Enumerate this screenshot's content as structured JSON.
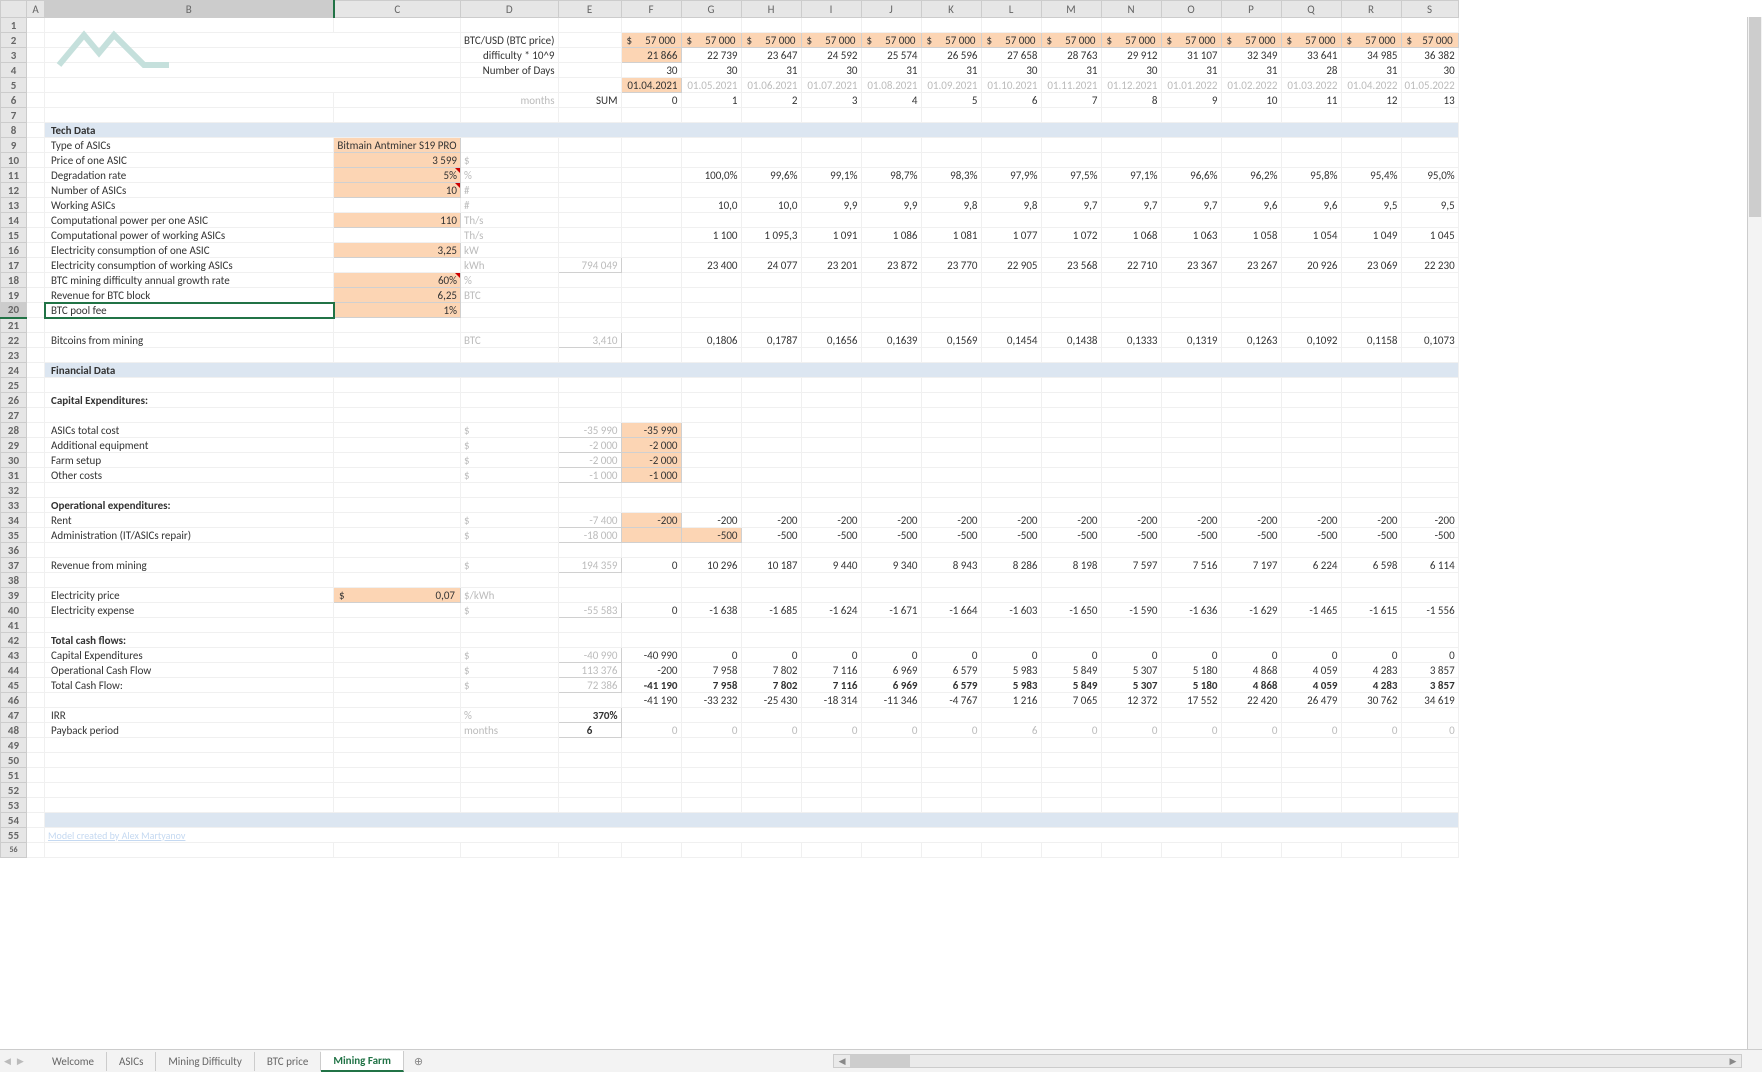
{
  "tabs": [
    "Welcome",
    "ASICs",
    "Mining Difficulty",
    "BTC price",
    "Mining Farm"
  ],
  "active_tab": "Mining Farm",
  "cols": [
    "A",
    "B",
    "C",
    "D",
    "E",
    "F",
    "G",
    "H",
    "I",
    "J",
    "K",
    "L",
    "M",
    "N",
    "O",
    "P",
    "Q",
    "R",
    "S"
  ],
  "rownums": 56,
  "r2_label": "BTC/USD (BTC price)",
  "r2_vals": [
    "57 000",
    "57 000",
    "57 000",
    "57 000",
    "57 000",
    "57 000",
    "57 000",
    "57 000",
    "57 000",
    "57 000",
    "57 000",
    "57 000",
    "57 000",
    "57 000"
  ],
  "r3_label": "difficulty * 10^9",
  "r3_first": "21 866",
  "r3_vals": [
    "22 739",
    "23 647",
    "24 592",
    "25 574",
    "26 596",
    "27 658",
    "28 763",
    "29 912",
    "31 107",
    "32 349",
    "33 641",
    "34 985",
    "36 382"
  ],
  "r4_label": "Number of Days",
  "r4_vals": [
    "30",
    "30",
    "31",
    "30",
    "31",
    "31",
    "30",
    "31",
    "30",
    "31",
    "31",
    "28",
    "31",
    "30"
  ],
  "r5_first": "01.04.2021",
  "r5_dates": [
    "01.05.2021",
    "01.06.2021",
    "01.07.2021",
    "01.08.2021",
    "01.09.2021",
    "01.10.2021",
    "01.11.2021",
    "01.12.2021",
    "01.01.2022",
    "01.02.2022",
    "01.03.2022",
    "01.04.2022",
    "01.05.2022"
  ],
  "r6_months": "months",
  "r6_sum": "SUM",
  "r6_nums": [
    "0",
    "1",
    "2",
    "3",
    "4",
    "5",
    "6",
    "7",
    "8",
    "9",
    "10",
    "11",
    "12",
    "13"
  ],
  "tech_header": "Tech Data",
  "r9_l": "Type of ASICs",
  "r9_v": "Bitmain Antminer S19 PRO",
  "r10_l": "Price of one ASIC",
  "r10_v": "3 599",
  "r10_u": "$",
  "r11_l": "Degradation rate",
  "r11_v": "5%",
  "r11_u": "%",
  "r11_vals": [
    "100,0%",
    "99,6%",
    "99,1%",
    "98,7%",
    "98,3%",
    "97,9%",
    "97,5%",
    "97,1%",
    "96,6%",
    "96,2%",
    "95,8%",
    "95,4%",
    "95,0%"
  ],
  "r12_l": "Number of ASICs",
  "r12_v": "10",
  "r12_u": "#",
  "r13_l": "Working ASICs",
  "r13_u": "#",
  "r13_vals": [
    "10,0",
    "10,0",
    "9,9",
    "9,9",
    "9,8",
    "9,8",
    "9,7",
    "9,7",
    "9,7",
    "9,6",
    "9,6",
    "9,5",
    "9,5"
  ],
  "r14_l": "Computational power per one ASIC",
  "r14_v": "110",
  "r14_u": "Th/s",
  "r15_l": "Computational power of working ASICs",
  "r15_u": "Th/s",
  "r15_vals": [
    "1 100",
    "1 095,3",
    "1 091",
    "1 086",
    "1 081",
    "1 077",
    "1 072",
    "1 068",
    "1 063",
    "1 058",
    "1 054",
    "1 049",
    "1 045"
  ],
  "r16_l": "Electricity consumption of one ASIC",
  "r16_v": "3,25",
  "r16_u": "kW",
  "r17_l": "Electricity consumption of working ASICs",
  "r17_u": "kWh",
  "r17_sum": "794 049",
  "r17_vals": [
    "23 400",
    "24 077",
    "23 201",
    "23 872",
    "23 770",
    "22 905",
    "23 568",
    "22 710",
    "23 367",
    "23 267",
    "20 926",
    "23 069",
    "22 230"
  ],
  "r18_l": "BTC mining difficulty annual growth rate",
  "r18_v": "60%",
  "r18_u": "%",
  "r19_l": "Revenue for BTC block",
  "r19_v": "6,25",
  "r19_u": "BTC",
  "r20_l": "BTC pool fee",
  "r20_v": "1%",
  "r22_l": "Bitcoins from mining",
  "r22_u": "BTC",
  "r22_sum": "3,410",
  "r22_vals": [
    "0,1806",
    "0,1787",
    "0,1656",
    "0,1639",
    "0,1569",
    "0,1454",
    "0,1438",
    "0,1333",
    "0,1319",
    "0,1263",
    "0,1092",
    "0,1158",
    "0,1073"
  ],
  "fin_header": "Financial Data",
  "r26_l": "Capital Expenditures:",
  "r28_l": "ASICs total cost",
  "r28_u": "$",
  "r28_sum": "-35 990",
  "r28_f": "-35 990",
  "r29_l": "Additional equipment",
  "r29_u": "$",
  "r29_sum": "-2 000",
  "r29_f": "-2 000",
  "r30_l": "Farm setup",
  "r30_u": "$",
  "r30_sum": "-2 000",
  "r30_f": "-2 000",
  "r31_l": "Other costs",
  "r31_u": "$",
  "r31_sum": "-1 000",
  "r31_f": "-1 000",
  "r33_l": "Operational expenditures:",
  "r34_l": "Rent",
  "r34_u": "$",
  "r34_sum": "-7 400",
  "r34_f": "-200",
  "r34_vals": [
    "-200",
    "-200",
    "-200",
    "-200",
    "-200",
    "-200",
    "-200",
    "-200",
    "-200",
    "-200",
    "-200",
    "-200",
    "-200"
  ],
  "r35_l": "Administration (IT/ASICs repair)",
  "r35_u": "$",
  "r35_sum": "-18 000",
  "r35_g": "-500",
  "r35_vals": [
    "-500",
    "-500",
    "-500",
    "-500",
    "-500",
    "-500",
    "-500",
    "-500",
    "-500",
    "-500",
    "-500",
    "-500"
  ],
  "r37_l": "Revenue from mining",
  "r37_u": "$",
  "r37_sum": "194 359",
  "r37_vals": [
    "0",
    "10 296",
    "10 187",
    "9 440",
    "9 340",
    "8 943",
    "8 286",
    "8 198",
    "7 597",
    "7 516",
    "7 197",
    "6 224",
    "6 598",
    "6 114"
  ],
  "r39_l": "Electricity price",
  "r39_v": "0,07",
  "r39_pre": "$",
  "r39_u": "$/kWh",
  "r40_l": "Electricity expense",
  "r40_u": "$",
  "r40_sum": "-55 583",
  "r40_vals": [
    "0",
    "-1 638",
    "-1 685",
    "-1 624",
    "-1 671",
    "-1 664",
    "-1 603",
    "-1 650",
    "-1 590",
    "-1 636",
    "-1 629",
    "-1 465",
    "-1 615",
    "-1 556"
  ],
  "r42_l": "Total cash flows:",
  "r43_l": "Capital Expenditures",
  "r43_u": "$",
  "r43_sum": "-40 990",
  "r43_vals": [
    "-40 990",
    "0",
    "0",
    "0",
    "0",
    "0",
    "0",
    "0",
    "0",
    "0",
    "0",
    "0",
    "0",
    "0"
  ],
  "r44_l": "Operational Cash Flow",
  "r44_u": "$",
  "r44_sum": "113 376",
  "r44_vals": [
    "-200",
    "7 958",
    "7 802",
    "7 116",
    "6 969",
    "6 579",
    "5 983",
    "5 849",
    "5 307",
    "5 180",
    "4 868",
    "4 059",
    "4 283",
    "3 857"
  ],
  "r45_l": "Total Cash Flow:",
  "r45_u": "$",
  "r45_sum": "72 386",
  "r45_vals": [
    "-41 190",
    "7 958",
    "7 802",
    "7 116",
    "6 969",
    "6 579",
    "5 983",
    "5 849",
    "5 307",
    "5 180",
    "4 868",
    "4 059",
    "4 283",
    "3 857"
  ],
  "r46_vals": [
    "-41 190",
    "-33 232",
    "-25 430",
    "-18 314",
    "-11 346",
    "-4 767",
    "1 216",
    "7 065",
    "12 372",
    "17 552",
    "22 420",
    "26 479",
    "30 762",
    "34 619"
  ],
  "r47_l": "IRR",
  "r47_u": "%",
  "r47_v": "370%",
  "r48_l": "Payback period",
  "r48_u": "months",
  "r48_v": "6",
  "r48_vals": [
    "0",
    "0",
    "0",
    "0",
    "0",
    "0",
    "6",
    "0",
    "0",
    "0",
    "0",
    "0",
    "0",
    "0"
  ],
  "credit": "Model created by Alex Martyanov",
  "dollar": "$"
}
